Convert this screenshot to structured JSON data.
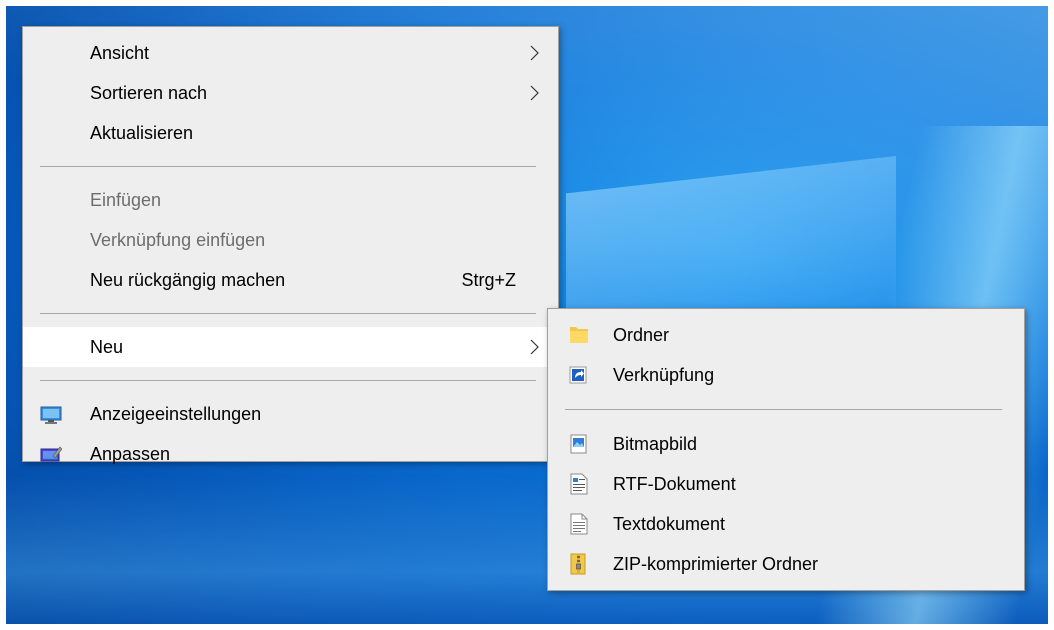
{
  "desktop": {
    "accent": "#0a74d9"
  },
  "context_menu": {
    "items": [
      {
        "label": "Ansicht",
        "submenu": true
      },
      {
        "label": "Sortieren nach",
        "submenu": true
      },
      {
        "label": "Aktualisieren"
      }
    ],
    "items2": [
      {
        "label": "Einfügen",
        "disabled": true
      },
      {
        "label": "Verknüpfung einfügen",
        "disabled": true
      },
      {
        "label": "Neu rückgängig machen",
        "shortcut": "Strg+Z"
      }
    ],
    "neu": {
      "label": "Neu",
      "submenu": true,
      "highlighted": true
    },
    "items3": [
      {
        "label": "Anzeigeeinstellungen",
        "icon": "display-settings-icon"
      },
      {
        "label": "Anpassen",
        "icon": "personalize-icon"
      }
    ]
  },
  "submenu_neu": {
    "items": [
      {
        "label": "Ordner",
        "icon": "folder-icon"
      },
      {
        "label": "Verknüpfung",
        "icon": "shortcut-icon"
      }
    ],
    "items2": [
      {
        "label": "Bitmapbild",
        "icon": "bitmap-icon"
      },
      {
        "label": "RTF-Dokument",
        "icon": "rtf-document-icon"
      },
      {
        "label": "Textdokument",
        "icon": "text-document-icon"
      },
      {
        "label": "ZIP-komprimierter Ordner",
        "icon": "zip-folder-icon"
      }
    ]
  }
}
